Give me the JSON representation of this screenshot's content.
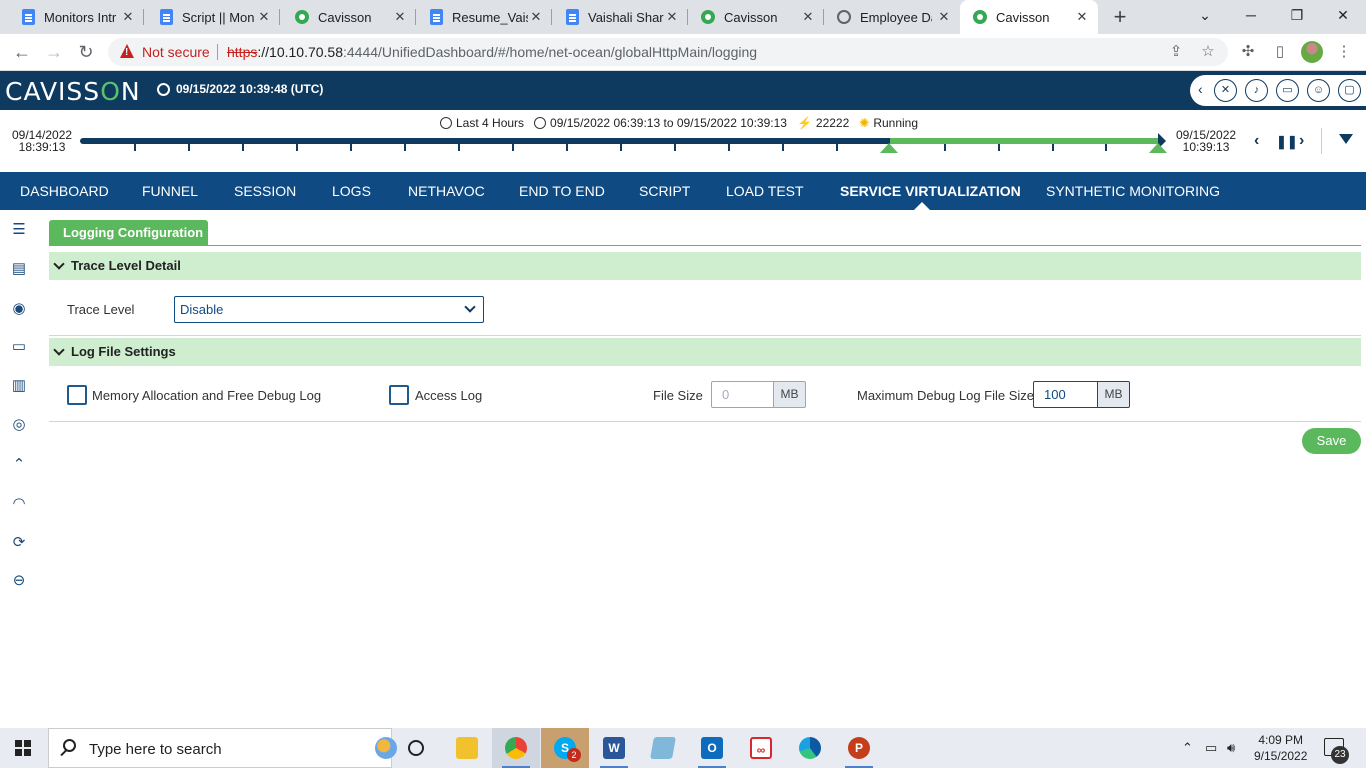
{
  "browser": {
    "tabs": [
      {
        "title": "Monitors Intr",
        "favicon": "doc-icon"
      },
      {
        "title": "Script || Moni",
        "favicon": "doc-icon"
      },
      {
        "title": "Cavisson",
        "favicon": "cavisson-icon"
      },
      {
        "title": "Resume_Vaish",
        "favicon": "doc-icon"
      },
      {
        "title": "Vaishali Sharm",
        "favicon": "doc-icon"
      },
      {
        "title": "Cavisson",
        "favicon": "cavisson-icon"
      },
      {
        "title": "Employee Da",
        "favicon": "globe-icon"
      },
      {
        "title": "Cavisson",
        "favicon": "cavisson-icon",
        "active": true
      }
    ],
    "security_label": "Not secure",
    "url_scheme": "https",
    "url_host": "://10.10.70.58",
    "url_rest": ":4444/UnifiedDashboard/#/home/net-ocean/globalHttpMain/logging"
  },
  "app": {
    "logo_pre": "CAVISS",
    "logo_o": "O",
    "logo_post": "N",
    "header_time": "09/15/2022 10:39:48 (UTC)"
  },
  "timeline": {
    "start_date": "09/14/2022",
    "start_time": "18:39:13",
    "end_date": "09/15/2022",
    "end_time": "10:39:13",
    "preset": "Last 4 Hours",
    "range": "09/15/2022 06:39:13 to 09/15/2022 10:39:13",
    "count": "22222",
    "status": "Running"
  },
  "nav": {
    "items": [
      "DASHBOARD",
      "FUNNEL",
      "SESSION",
      "LOGS",
      "NETHAVOC",
      "END TO END",
      "SCRIPT",
      "LOAD TEST",
      "SERVICE VIRTUALIZATION",
      "SYNTHETIC MONITORING"
    ],
    "active": "SERVICE VIRTUALIZATION"
  },
  "content": {
    "tab_label": "Logging Configuration",
    "trace_section": "Trace Level Detail",
    "trace_level_label": "Trace Level",
    "trace_level_value": "Disable",
    "log_section": "Log File Settings",
    "memory_log_label": "Memory Allocation and Free Debug Log",
    "access_log_label": "Access Log",
    "file_size_label": "File Size",
    "file_size_placeholder": "0",
    "file_size_unit": "MB",
    "max_debug_label": "Maximum Debug Log File Size",
    "max_debug_value": "100",
    "max_debug_unit": "MB",
    "save_label": "Save"
  },
  "taskbar": {
    "search_placeholder": "Type here to search",
    "time": "4:09 PM",
    "date": "9/15/2022",
    "notification_count": "23",
    "skype_badge": "2",
    "word_label": "W",
    "powerpoint_label": "P"
  },
  "colors": {
    "header_bg": "#0f3a5f",
    "nav_bg": "#0f4a82",
    "accent_green": "#5cb85c",
    "section_bg": "#cfeecf"
  }
}
